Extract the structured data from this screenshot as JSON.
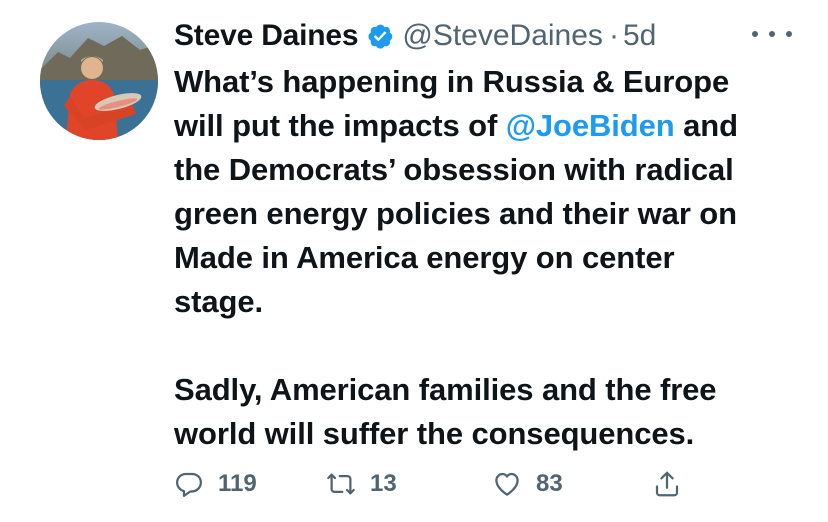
{
  "tweet": {
    "author_name": "Steve Daines",
    "handle": "@SteveDaines",
    "separator": "·",
    "age": "5d",
    "text_line1_a": "What’s happening in Russia & Europe",
    "text_line2_a": "will put the impacts of ",
    "mention": "@JoeBiden",
    "text_line2_b": " and",
    "text_line3": "the Democrats’ obsession with radical",
    "text_line4": "green energy policies and their war on",
    "text_line5": "Made in America energy on center",
    "text_line6": "stage.",
    "text_p2_line1": "Sadly, American families and the free",
    "text_p2_line2": "world will suffer the consequences."
  },
  "actions": {
    "replies": "119",
    "retweets": "13",
    "likes": "83"
  },
  "icons": {
    "verified": "verified-badge-icon",
    "more": "more-dots-icon",
    "reply": "reply-bubble-icon",
    "retweet": "retweet-icon",
    "like": "heart-icon",
    "share": "share-icon"
  },
  "colors": {
    "text": "#0f1419",
    "secondary": "#536471",
    "accent": "#1d9bf0"
  }
}
